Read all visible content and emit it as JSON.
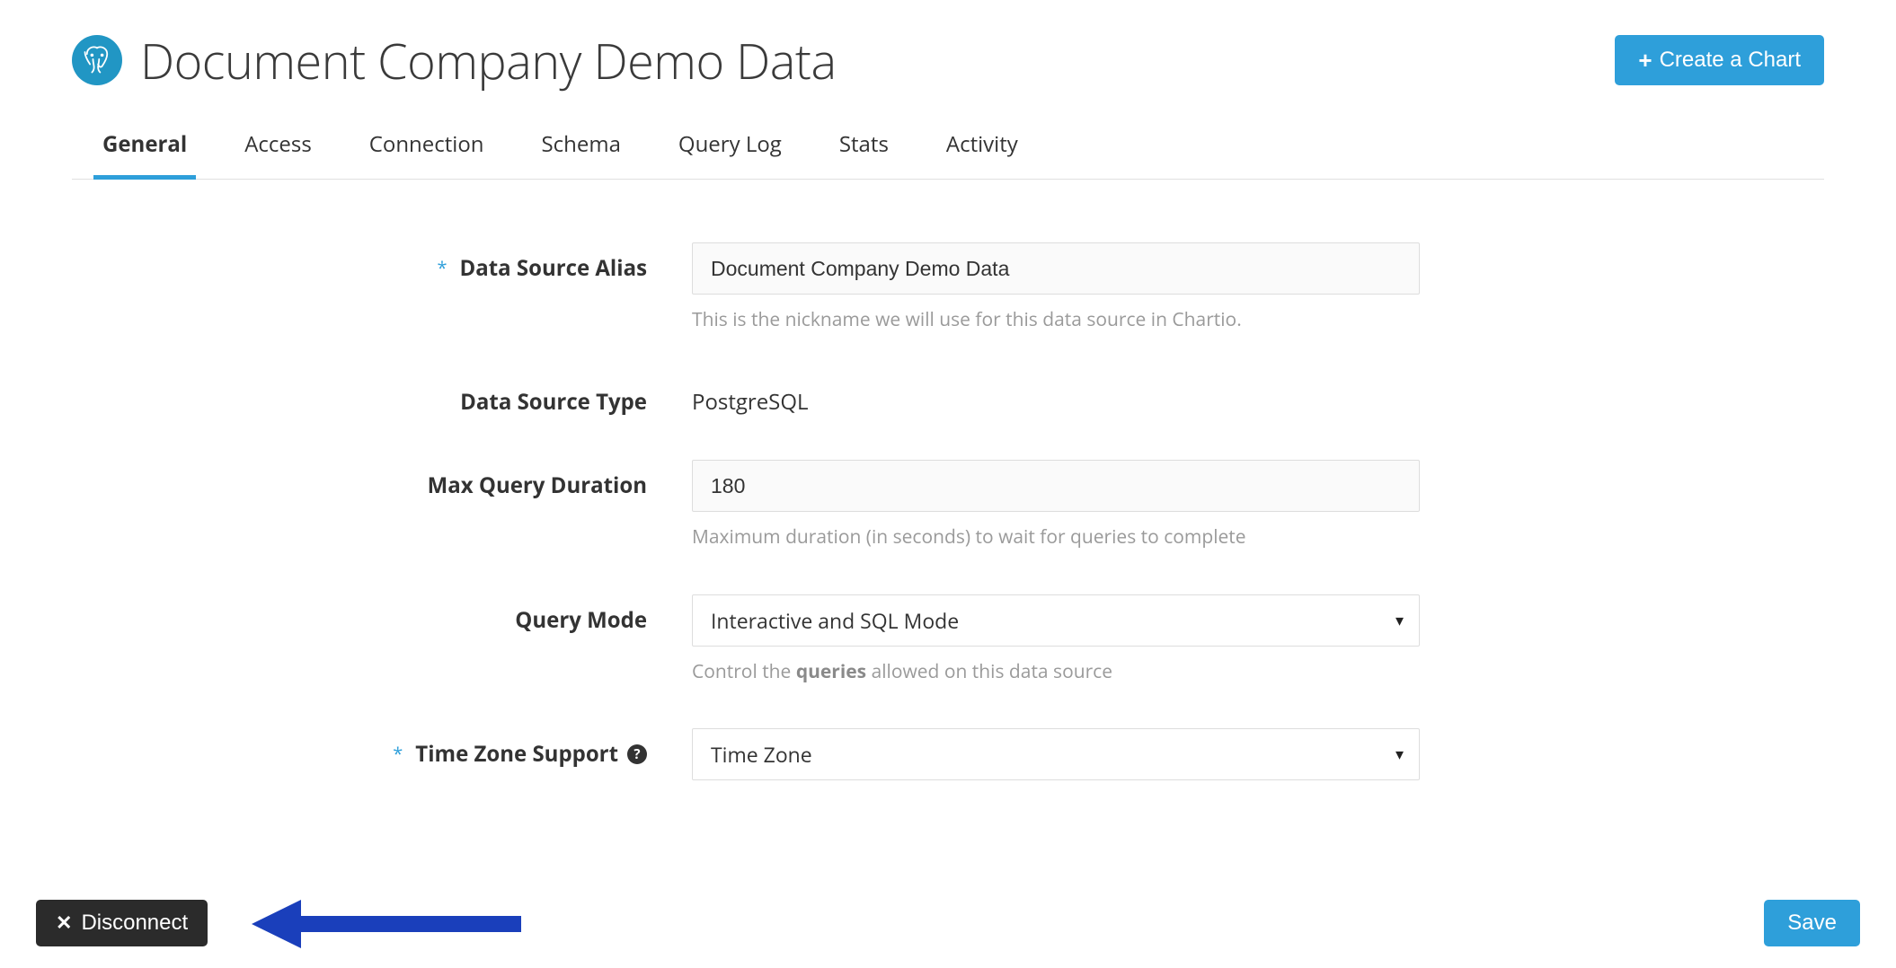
{
  "header": {
    "title": "Document Company Demo Data",
    "create_chart_label": "Create a Chart"
  },
  "tabs": [
    {
      "label": "General",
      "active": true
    },
    {
      "label": "Access",
      "active": false
    },
    {
      "label": "Connection",
      "active": false
    },
    {
      "label": "Schema",
      "active": false
    },
    {
      "label": "Query Log",
      "active": false
    },
    {
      "label": "Stats",
      "active": false
    },
    {
      "label": "Activity",
      "active": false
    }
  ],
  "form": {
    "alias": {
      "label": "Data Source Alias",
      "required": true,
      "value": "Document Company Demo Data",
      "help": "This is the nickname we will use for this data source in Chartio."
    },
    "type": {
      "label": "Data Source Type",
      "value": "PostgreSQL"
    },
    "max_query_duration": {
      "label": "Max Query Duration",
      "value": "180",
      "help": "Maximum duration (in seconds) to wait for queries to complete"
    },
    "query_mode": {
      "label": "Query Mode",
      "value": "Interactive and SQL Mode",
      "help_pre": "Control the ",
      "help_bold": "queries",
      "help_post": " allowed on this data source"
    },
    "timezone": {
      "label": "Time Zone Support",
      "required": true,
      "value": "Time Zone"
    }
  },
  "footer": {
    "disconnect_label": "Disconnect",
    "save_label": "Save"
  },
  "colors": {
    "accent": "#2e9fda",
    "dark": "#2b2b2b"
  }
}
